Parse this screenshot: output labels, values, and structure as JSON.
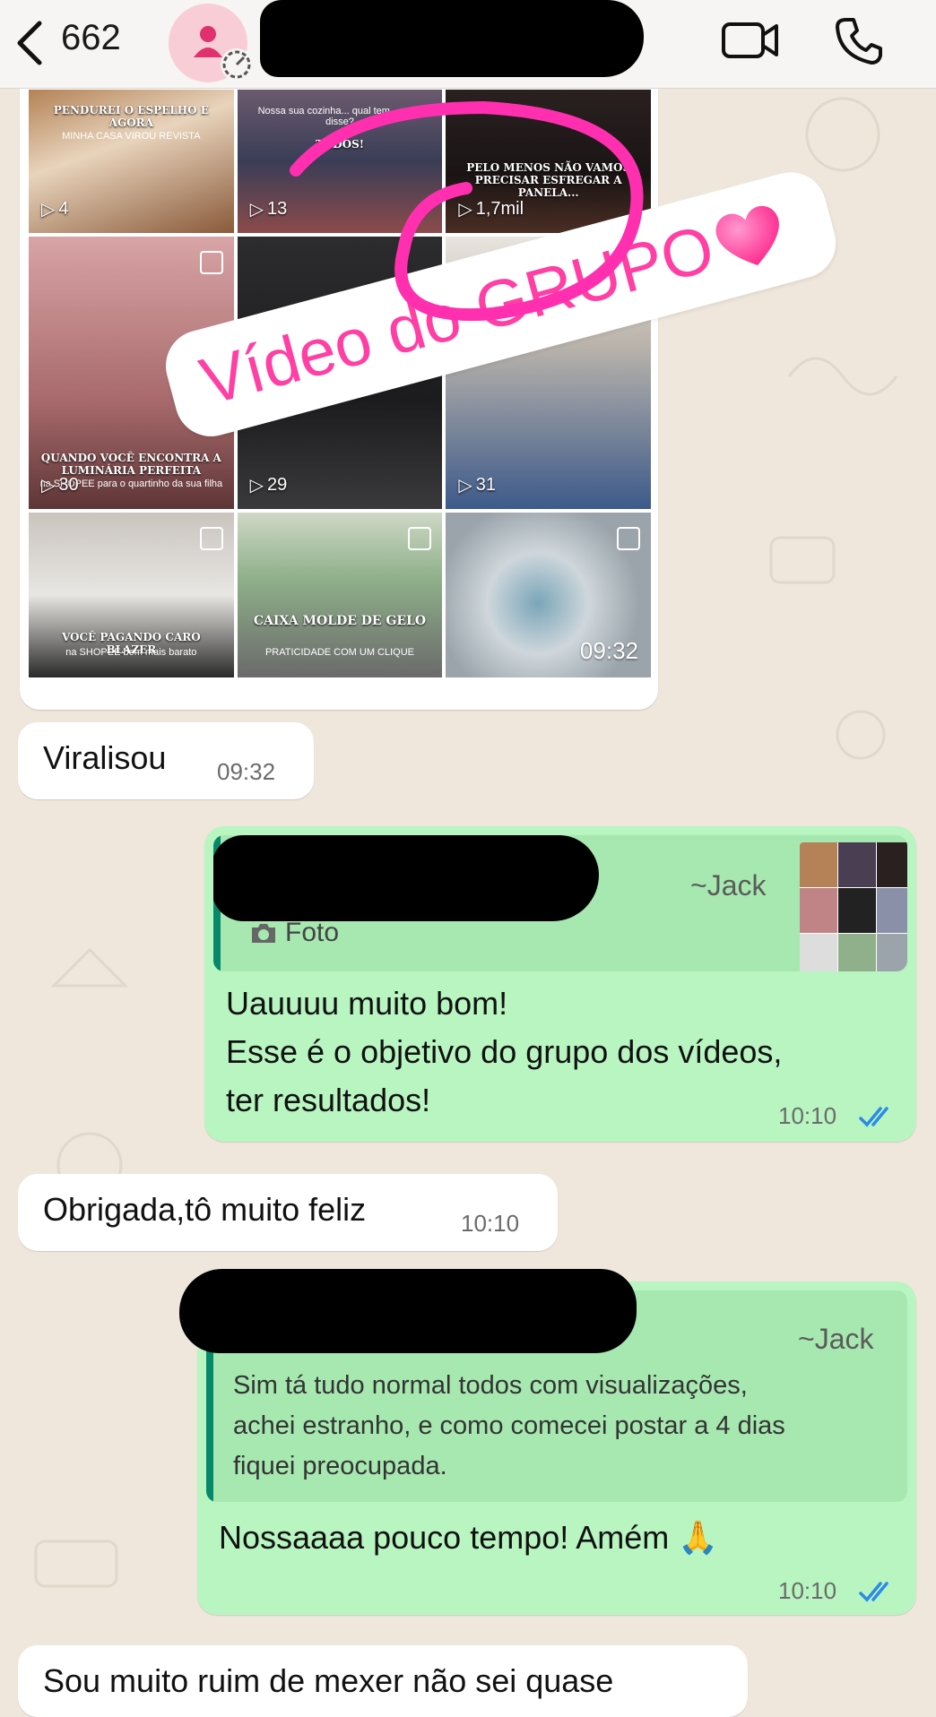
{
  "header": {
    "back_count": "662"
  },
  "media_grid": {
    "cells": [
      {
        "count": "4",
        "overlay": "PENDUREI O ESPELHO E AGORA",
        "sub": "MINHA CASA VIROU REVISTA"
      },
      {
        "count": "13",
        "overlay": "TODOS!",
        "sub": "Nossa sua cozinha... qual tem... você disse?"
      },
      {
        "count": "1,7mil",
        "overlay": "PELO MENOS NÃO VAMOS PRECISAR ESFREGAR A PANELA...",
        "sub": ""
      },
      {
        "count": "30",
        "overlay": "QUANDO VOCÊ ENCONTRA A LUMINÁRIA PERFEITA",
        "sub": "na SHOPEE para o quartinho da sua filha"
      },
      {
        "count": "29",
        "overlay": "",
        "sub": ""
      },
      {
        "count": "31",
        "overlay": "",
        "sub": ""
      },
      {
        "count": "",
        "overlay": "VOCÊ PAGANDO CARO BLAZER",
        "sub": "na SHOPEE bem mais barato"
      },
      {
        "count": "",
        "overlay": "CAIXA MOLDE DE GELO",
        "sub": "PRATICIDADE COM UM CLIQUE"
      },
      {
        "count": "",
        "overlay": "",
        "sub": ""
      }
    ],
    "time": "09:32"
  },
  "sticker": {
    "text": "Vídeo do GRUPO"
  },
  "messages": [
    {
      "text": "Viralisou",
      "time": "09:32"
    },
    {
      "quote_author": "~Jack",
      "quote_type": "Foto",
      "lines": [
        "Uauuuu muito bom!",
        "Esse é o objetivo do grupo dos vídeos,",
        "ter resultados!"
      ],
      "time": "10:10"
    },
    {
      "text": "Obrigada,tô muito feliz",
      "time": "10:10"
    },
    {
      "quote_author": "~Jack",
      "quote_lines": [
        "Sim tá tudo normal todos com visualizações,",
        "achei estranho, e como comecei postar a 4 dias",
        "fiquei preocupada."
      ],
      "text": "Nossaaaa pouco tempo! Amém 🙏",
      "time": "10:10"
    },
    {
      "text": "Sou muito ruim de mexer não sei quase"
    }
  ],
  "colors": {
    "accent_pink": "#ff3fa4",
    "bubble_out": "#d9fdd3",
    "read_ticks": "#2b8be6"
  }
}
